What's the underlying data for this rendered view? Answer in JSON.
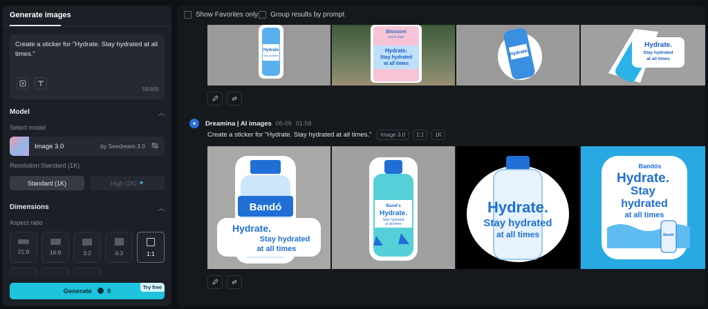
{
  "left_panel": {
    "tab_label": "Generate images",
    "prompt_text": "Create a sticker for \"Hydrate. Stay hydrated at all times.\"",
    "char_counter": "59/800",
    "model_section": {
      "title": "Model",
      "select_label": "Select model",
      "model_name": "Image 3.0",
      "model_by": "by Seedream 3.0"
    },
    "resolution": {
      "label": "Resolution:Standard (1K)",
      "standard": "Standard (1K)",
      "high": "High (2K)"
    },
    "dimensions": {
      "title": "Dimensions",
      "aspect_label": "Aspect ratio",
      "ratios": [
        "21:9",
        "16:9",
        "3:2",
        "4:3",
        "1:1"
      ],
      "selected": "1:1"
    },
    "generate": {
      "label": "Generate",
      "cost": "0",
      "badge": "Try free"
    }
  },
  "right_panel": {
    "filters": {
      "favorites": "Show Favorites only",
      "group": "Group results by prompt"
    },
    "top_group": {
      "images": [
        {
          "texts": [
            "Hydrate",
            "Stay hydrated"
          ]
        },
        {
          "texts": [
            "Blossom",
            "Street Style",
            "Hydrate.",
            "Stay hydrated",
            "at all times"
          ]
        },
        {
          "texts": [
            "Hydrate."
          ]
        },
        {
          "texts": [
            "Hydrate.",
            "Stay hydrated",
            "at all times"
          ]
        }
      ]
    },
    "bottom_group": {
      "author": "Dreamina | AI images",
      "date": "06-09",
      "time": "01:58",
      "prompt": "Create a sticker for \"Hydrate. Stay hydrated at all times.\"",
      "tags": [
        "Image 3.0",
        "1:1",
        "1K"
      ],
      "images": [
        {
          "texts": [
            "Bandó",
            "Hydrate.",
            "Stay hydrated",
            "at all times"
          ]
        },
        {
          "texts": [
            "Band's",
            "Hydrate.",
            "Stay hydrated",
            "at all times"
          ]
        },
        {
          "texts": [
            "Hydrate.",
            "Stay hydrated",
            "at all times"
          ]
        },
        {
          "texts": [
            "Bandós",
            "Hydrate.",
            "Stay",
            "hydrated",
            "at all times",
            "Bandó"
          ]
        }
      ]
    }
  },
  "colors": {
    "accent": "#1ec3dd",
    "panel": "#1b1f26",
    "background": "#0e1116"
  }
}
